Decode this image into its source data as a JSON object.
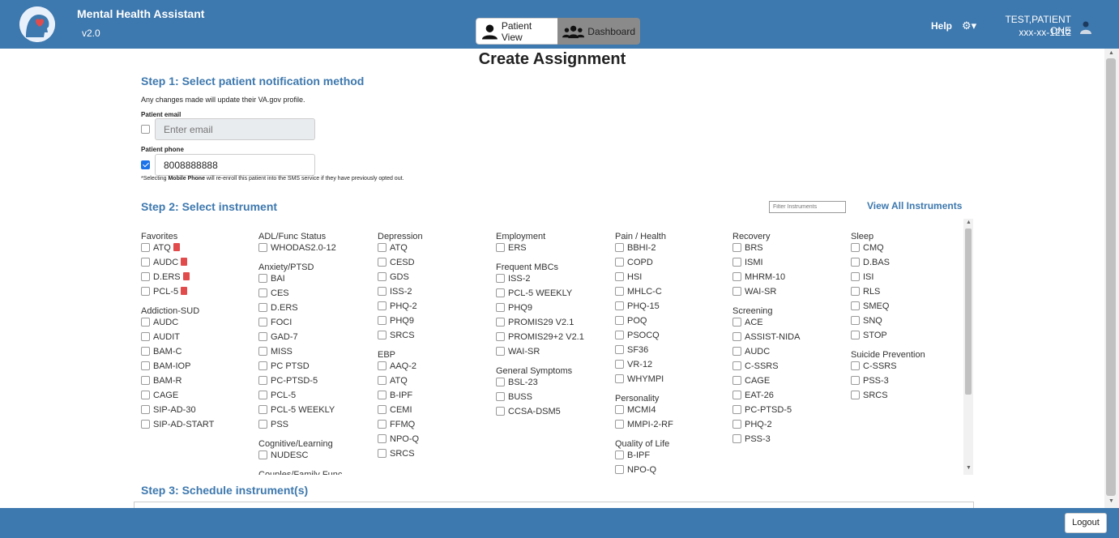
{
  "header": {
    "app_title": "Mental Health Assistant",
    "version": "v2.0",
    "patient_view_label": "Patient View",
    "dashboard_label": "Dashboard",
    "help_label": "Help",
    "patient_name": "TEST,PATIENT ONE",
    "patient_ssn": "xxx-xx-1212"
  },
  "page": {
    "title": "Create Assignment"
  },
  "step1": {
    "heading": "Step 1: Select patient notification method",
    "note": "Any changes made will update their VA.gov profile.",
    "email_label": "Patient email",
    "email_placeholder": "Enter email",
    "email_checked": false,
    "phone_label": "Patient phone",
    "phone_value": "8008888888",
    "phone_checked": true,
    "footnote": "*Selecting Mobile Phone will re-enroll this patient into the SMS service if they have previously opted out."
  },
  "step2": {
    "heading": "Step 2: Select instrument",
    "filter_placeholder": "Filter Instruments",
    "view_all_label": "View All Instruments",
    "columns": [
      {
        "groups": [
          {
            "name": "Favorites",
            "items": [
              "ATQ",
              "AUDC",
              "D.ERS",
              "PCL-5"
            ],
            "deletable": true
          },
          {
            "name": "Addiction-SUD",
            "items": [
              "AUDC",
              "AUDIT",
              "BAM-C",
              "BAM-IOP",
              "BAM-R",
              "CAGE",
              "SIP-AD-30",
              "SIP-AD-START"
            ]
          }
        ]
      },
      {
        "groups": [
          {
            "name": "ADL/Func Status",
            "items": [
              "WHODAS2.0-12"
            ]
          },
          {
            "name": "Anxiety/PTSD",
            "items": [
              "BAI",
              "CES",
              "D.ERS",
              "FOCI",
              "GAD-7",
              "MISS",
              "PC PTSD",
              "PC-PTSD-5",
              "PCL-5",
              "PCL-5 WEEKLY",
              "PSS"
            ]
          },
          {
            "name": "Cognitive/Learning",
            "items": [
              "NUDESC"
            ]
          },
          {
            "name": "Couples/Family Func",
            "items": []
          }
        ]
      },
      {
        "groups": [
          {
            "name": "Depression",
            "items": [
              "ATQ",
              "CESD",
              "GDS",
              "ISS-2",
              "PHQ-2",
              "PHQ9",
              "SRCS"
            ]
          },
          {
            "name": "EBP",
            "items": [
              "AAQ-2",
              "ATQ",
              "B-IPF",
              "CEMI",
              "FFMQ",
              "NPO-Q",
              "SRCS"
            ]
          }
        ]
      },
      {
        "groups": [
          {
            "name": "Employment",
            "items": [
              "ERS"
            ]
          },
          {
            "name": "Frequent MBCs",
            "items": [
              "ISS-2",
              "PCL-5 WEEKLY",
              "PHQ9",
              "PROMIS29 V2.1",
              "PROMIS29+2 V2.1",
              "WAI-SR"
            ]
          },
          {
            "name": "General Symptoms",
            "items": [
              "BSL-23",
              "BUSS",
              "CCSA-DSM5"
            ]
          }
        ]
      },
      {
        "groups": [
          {
            "name": "Pain / Health",
            "items": [
              "BBHI-2",
              "COPD",
              "HSI",
              "MHLC-C",
              "PHQ-15",
              "POQ",
              "PSOCQ",
              "SF36",
              "VR-12",
              "WHYMPI"
            ]
          },
          {
            "name": "Personality",
            "items": [
              "MCMI4",
              "MMPI-2-RF"
            ]
          },
          {
            "name": "Quality of Life",
            "items": [
              "B-IPF",
              "NPO-Q"
            ]
          }
        ]
      },
      {
        "groups": [
          {
            "name": "Recovery",
            "items": [
              "BRS",
              "ISMI",
              "MHRM-10",
              "WAI-SR"
            ]
          },
          {
            "name": "Screening",
            "items": [
              "ACE",
              "ASSIST-NIDA",
              "AUDC",
              "C-SSRS",
              "CAGE",
              "EAT-26",
              "PC-PTSD-5",
              "PHQ-2",
              "PSS-3"
            ]
          }
        ]
      },
      {
        "groups": [
          {
            "name": "Sleep",
            "items": [
              "CMQ",
              "D.BAS",
              "ISI",
              "RLS",
              "SMEQ",
              "SNQ",
              "STOP"
            ]
          },
          {
            "name": "Suicide Prevention",
            "items": [
              "C-SSRS",
              "PSS-3",
              "SRCS"
            ]
          }
        ]
      }
    ]
  },
  "step3": {
    "heading": "Step 3: Schedule instrument(s)"
  },
  "footer": {
    "logout_label": "Logout"
  }
}
